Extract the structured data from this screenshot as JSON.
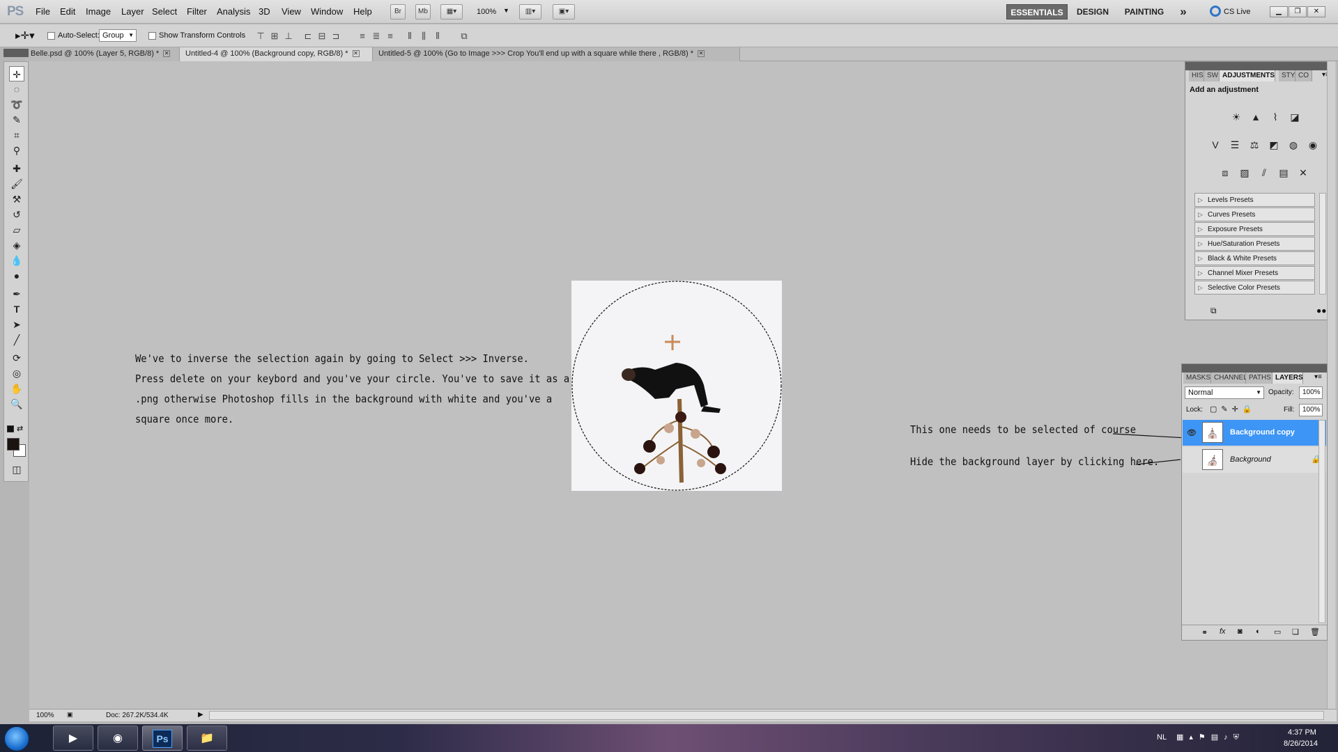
{
  "app": {
    "logo": "PS"
  },
  "menu": [
    "File",
    "Edit",
    "Image",
    "Layer",
    "Select",
    "Filter",
    "Analysis",
    "3D",
    "View",
    "Window",
    "Help"
  ],
  "appbar": {
    "bridge": "Br",
    "minibridge": "Mb",
    "zoom": "100%"
  },
  "workspaces": {
    "essentials": "ESSENTIALS",
    "design": "DESIGN",
    "painting": "PAINTING",
    "more": "»",
    "cslive": "CS Live"
  },
  "options": {
    "auto_select_label": "Auto-Select:",
    "auto_select_value": "Group",
    "transform_label": "Show Transform Controls"
  },
  "tabs": [
    {
      "label": "Belle.psd @ 100% (Layer 5, RGB/8) *"
    },
    {
      "label": "Untitled-4 @ 100% (Background copy, RGB/8) *"
    },
    {
      "label": "Untitled-5 @ 100% (Go to Image >>> Crop   You'll end up with a square while there , RGB/8) *"
    }
  ],
  "annotations": {
    "main": [
      "We've to inverse the selection again by going to Select >>> Inverse.",
      "Press delete on your keybord and you've your circle. You've to save it as a",
      ".png otherwise Photoshop fills in the background with white and you've a",
      "square once more."
    ],
    "select_note": "This one needs to be selected of course",
    "hide_note": "Hide the background layer by clicking here."
  },
  "adjust_panel": {
    "tabs": [
      "HIS",
      "SW",
      "ADJUSTMENTS",
      "STY",
      "CO"
    ],
    "title": "Add an adjustment",
    "presets": [
      "Levels Presets",
      "Curves Presets",
      "Exposure Presets",
      "Hue/Saturation Presets",
      "Black & White Presets",
      "Channel Mixer Presets",
      "Selective Color Presets"
    ]
  },
  "layers_panel": {
    "tabs": [
      "MASKS",
      "CHANNEL",
      "PATHS",
      "LAYERS"
    ],
    "blend_mode": "Normal",
    "opacity_label": "Opacity:",
    "opacity": "100%",
    "lock_label": "Lock:",
    "fill_label": "Fill:",
    "fill": "100%",
    "layers": [
      {
        "name": "Background copy"
      },
      {
        "name": "Background"
      }
    ]
  },
  "status": {
    "zoom": "100%",
    "doc": "Doc: 267.2K/534.4K"
  },
  "taskbar": {
    "lang": "NL",
    "time": "4:37 PM",
    "date": "8/26/2014"
  },
  "colors": {
    "selection_blue": "#3d95f5",
    "canvas": "#c0c0c0"
  }
}
